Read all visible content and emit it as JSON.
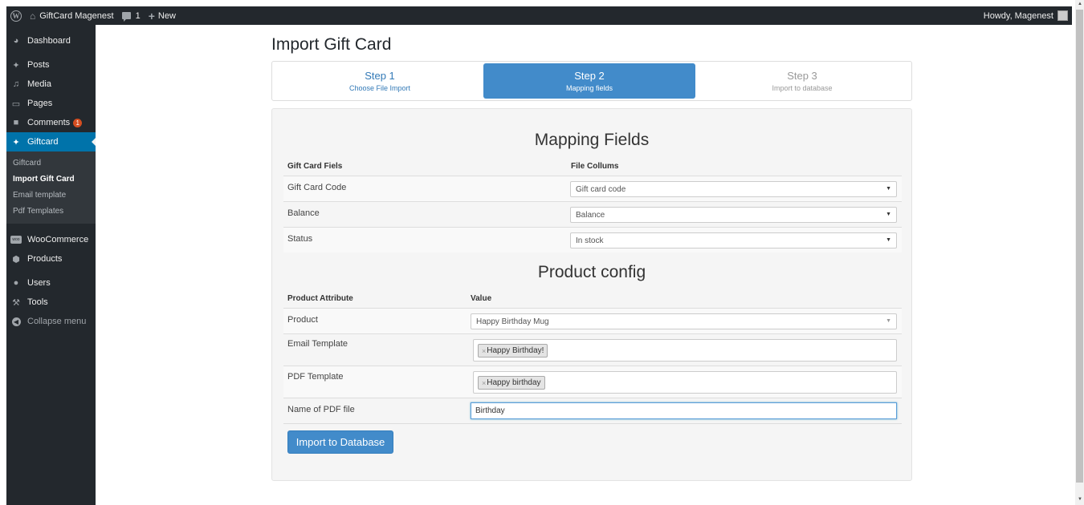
{
  "adminbar": {
    "site_name": "GiftCard Magenest",
    "comments_count": "1",
    "new_label": "New",
    "howdy": "Howdy, Magenest"
  },
  "sidebar": {
    "items": [
      {
        "label": "Dashboard",
        "icon": "dashboard-icon"
      },
      {
        "label": "Posts",
        "icon": "pin-icon"
      },
      {
        "label": "Media",
        "icon": "media-icon"
      },
      {
        "label": "Pages",
        "icon": "pages-icon"
      },
      {
        "label": "Comments",
        "icon": "comments-icon",
        "badge": "1"
      },
      {
        "label": "Giftcard",
        "icon": "pin-icon",
        "active": true
      }
    ],
    "submenu": [
      "Giftcard",
      "Import Gift Card",
      "Email template",
      "Pdf Templates"
    ],
    "items2": [
      {
        "label": "WooCommerce",
        "icon": "woo-icon"
      },
      {
        "label": "Products",
        "icon": "products-icon"
      },
      {
        "label": "Users",
        "icon": "users-icon"
      },
      {
        "label": "Tools",
        "icon": "tools-icon"
      },
      {
        "label": "Collapse menu",
        "icon": "collapse-icon"
      }
    ]
  },
  "main": {
    "title": "Import Gift Card",
    "steps": [
      {
        "title": "Step 1",
        "desc": "Choose File Import"
      },
      {
        "title": "Step 2",
        "desc": "Mapping fields"
      },
      {
        "title": "Step 3",
        "desc": "Import to database"
      }
    ],
    "mapping": {
      "title": "Mapping Fields",
      "col1": "Gift Card Fiels",
      "col2": "File Collums",
      "rows": [
        {
          "label": "Gift Card Code",
          "value": "Gift card code"
        },
        {
          "label": "Balance",
          "value": "Balance"
        },
        {
          "label": "Status",
          "value": "In stock"
        }
      ]
    },
    "product": {
      "title": "Product config",
      "col1": "Product Attribute",
      "col2": "Value",
      "product_label": "Product",
      "product_value": "Happy Birthday Mug",
      "email_label": "Email Template",
      "email_tag": "Happy Birthday!",
      "pdf_label": "PDF Template",
      "pdf_tag": "Happy birthday",
      "name_label": "Name of PDF file",
      "name_value": "Birthday"
    },
    "button": "Import to Database"
  },
  "colors": {
    "admin_bg": "#23282d",
    "active_blue": "#0073aa",
    "step_active": "#428bca",
    "badge": "#d54e21"
  }
}
